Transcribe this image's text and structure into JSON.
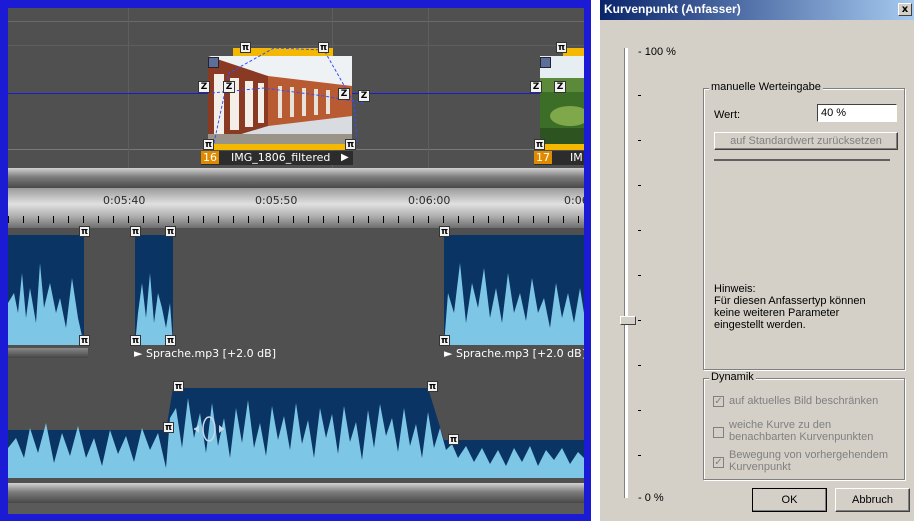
{
  "video_track": {
    "clips": [
      {
        "number": "16",
        "name": "IMG_1806_filtered"
      },
      {
        "number": "17",
        "name": "IM"
      }
    ],
    "handle_glyph": "π",
    "z_glyph": "Z",
    "play_glyph": "▶"
  },
  "ruler": {
    "ticks": [
      "0:05:40",
      "0:05:50",
      "0:06:00",
      "0:06"
    ]
  },
  "audio_track": {
    "clip_labels": [
      "Sprache.mp3 [+2.0 dB]",
      "Sprache.mp3 [+2.0 dB]"
    ]
  },
  "colors": {
    "editor_border": "#1b1bd6",
    "track_bg": "#4d4d4d",
    "clip_yellow": "#f5b800",
    "waveform_dark": "#0a3464",
    "waveform_light": "#7dc6e6",
    "dialog_bg": "#d4d0c8"
  },
  "dialog": {
    "title": "Kurvenpunkt (Anfasser)",
    "close_glyph": "x",
    "slider": {
      "top_label": "- 100 %",
      "bottom_label": "- 0 %",
      "value_percent": 40
    },
    "manual_group": {
      "legend": "manuelle Werteingabe",
      "value_label": "Wert:",
      "value": "40 %",
      "reset_button": "auf Standardwert zurücksetzen"
    },
    "hint": {
      "title": "Hinweis:",
      "line1": "Für diesen Anfassertyp können",
      "line2": "keine weiteren Parameter",
      "line3": "eingestellt werden."
    },
    "dynamics_group": {
      "legend": "Dynamik",
      "options": [
        {
          "line1": "auf aktuelles Bild beschränken",
          "line2": "",
          "checked": true
        },
        {
          "line1": "weiche Kurve zu den",
          "line2": "benachbarten Kurvenpunkten",
          "checked": false
        },
        {
          "line1": "Bewegung von vorhergehendem",
          "line2": "Kurvenpunkt",
          "checked": true
        }
      ]
    },
    "ok_button": "OK",
    "cancel_button": "Abbruch"
  }
}
